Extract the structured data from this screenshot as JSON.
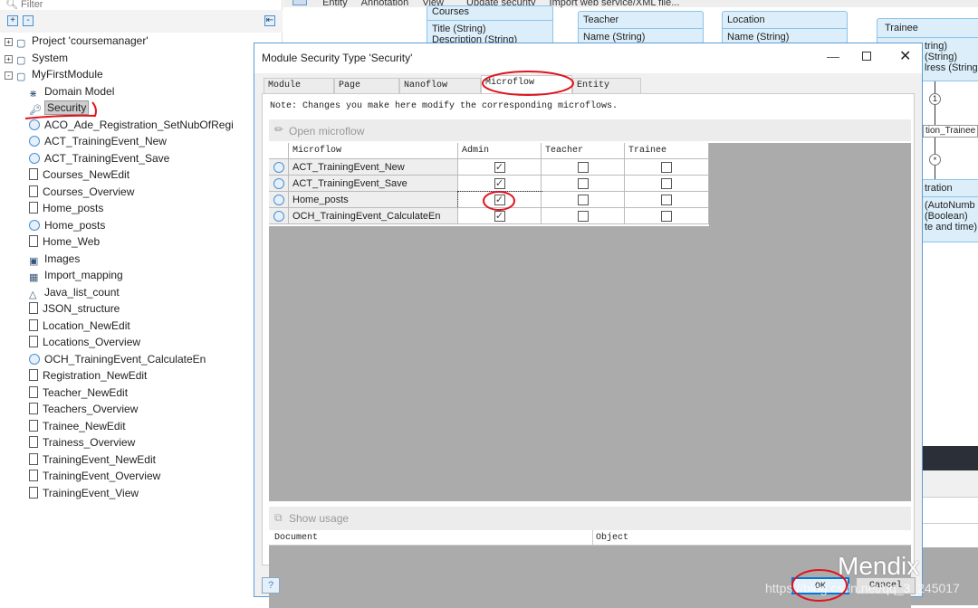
{
  "sidebar": {
    "filter_placeholder": "Filter",
    "items": [
      {
        "label": "Project 'coursemanager'",
        "icon": "project-icon",
        "level": 0
      },
      {
        "label": "System",
        "icon": "module-icon",
        "level": 0
      },
      {
        "label": "MyFirstModule",
        "icon": "module-icon",
        "level": 0
      },
      {
        "label": "Domain Model",
        "icon": "domain-model-icon",
        "level": 1
      },
      {
        "label": "Security",
        "icon": "key-icon",
        "level": 1,
        "selected": true
      },
      {
        "label": "ACO_Ade_Registration_SetNubOfRegi",
        "icon": "microflow-icon",
        "level": 1
      },
      {
        "label": "ACT_TrainingEvent_New",
        "icon": "microflow-icon",
        "level": 1
      },
      {
        "label": "ACT_TrainingEvent_Save",
        "icon": "microflow-icon",
        "level": 1
      },
      {
        "label": "Courses_NewEdit",
        "icon": "page-icon",
        "level": 1
      },
      {
        "label": "Courses_Overview",
        "icon": "page-icon",
        "level": 1
      },
      {
        "label": "Home_posts",
        "icon": "page-icon",
        "level": 1
      },
      {
        "label": "Home_posts",
        "icon": "microflow-icon",
        "level": 1
      },
      {
        "label": "Home_Web",
        "icon": "page-icon",
        "level": 1
      },
      {
        "label": "Images",
        "icon": "images-icon",
        "level": 1
      },
      {
        "label": "Import_mapping",
        "icon": "mapping-icon",
        "level": 1
      },
      {
        "label": "Java_list_count",
        "icon": "java-action-icon",
        "level": 1
      },
      {
        "label": "JSON_structure",
        "icon": "page-icon",
        "level": 1
      },
      {
        "label": "Location_NewEdit",
        "icon": "page-icon",
        "level": 1
      },
      {
        "label": "Locations_Overview",
        "icon": "page-icon",
        "level": 1
      },
      {
        "label": "OCH_TrainingEvent_CalculateEn",
        "icon": "microflow-icon",
        "level": 1
      },
      {
        "label": "Registration_NewEdit",
        "icon": "page-icon",
        "level": 1
      },
      {
        "label": "Teacher_NewEdit",
        "icon": "page-icon",
        "level": 1
      },
      {
        "label": "Teachers_Overview",
        "icon": "page-icon",
        "level": 1
      },
      {
        "label": "Trainee_NewEdit",
        "icon": "page-icon",
        "level": 1
      },
      {
        "label": "Trainess_Overview",
        "icon": "page-icon",
        "level": 1
      },
      {
        "label": "TrainingEvent_NewEdit",
        "icon": "page-icon",
        "level": 1
      },
      {
        "label": "TrainingEvent_Overview",
        "icon": "page-icon",
        "level": 1
      },
      {
        "label": "TrainingEvent_View",
        "icon": "page-icon",
        "level": 1
      }
    ]
  },
  "toolbar": {
    "entity": "Entity",
    "annotation": "Annotation",
    "view": "View",
    "update_security": "Update security",
    "import": "Import web service/XML file..."
  },
  "diagram": {
    "courses": {
      "title": "Courses",
      "attrs": "Title (String)\nDescription (String)"
    },
    "teacher": {
      "title": "Teacher",
      "attrs": "Name (String)"
    },
    "location": {
      "title": "Location",
      "attrs": "Name (String)"
    },
    "trainee": {
      "title": "Trainee",
      "attrs": "tring)\n(String)\nlress (String"
    },
    "association": "tion_Trainee",
    "mult_one": "1",
    "mult_many": "*",
    "registration": {
      "title": "tration",
      "attrs": "(AutoNumb\n(Boolean)\nte and time)"
    }
  },
  "dialog": {
    "title": "Module Security Type 'Security'",
    "tabs": [
      "Module roles",
      "Page access",
      "Nanoflow access",
      "Microflow access",
      "Entity access"
    ],
    "active_tab": "Microflow access",
    "note": "Note: Changes you make here modify the corresponding microflows.",
    "open_microflow": "Open microflow",
    "columns": [
      "Microflow",
      "Admin",
      "Teacher",
      "Trainee"
    ],
    "rows": [
      {
        "name": "ACT_TrainingEvent_New",
        "admin": true,
        "teacher": false,
        "trainee": false
      },
      {
        "name": "ACT_TrainingEvent_Save",
        "admin": true,
        "teacher": false,
        "trainee": false
      },
      {
        "name": "Home_posts",
        "admin": true,
        "teacher": false,
        "trainee": false
      },
      {
        "name": "OCH_TrainingEvent_CalculateEn",
        "admin": true,
        "teacher": false,
        "trainee": false
      }
    ],
    "show_usage": "Show usage",
    "usage_columns": [
      "Document",
      "Object"
    ],
    "ok": "OK",
    "cancel": "Cancel"
  },
  "watermark": {
    "brand": "Mendix",
    "url": "https://blog.csdn.net/qq_3_245017"
  },
  "colors": {
    "annotation_red": "#e0141e",
    "accent": "#0078d7"
  }
}
